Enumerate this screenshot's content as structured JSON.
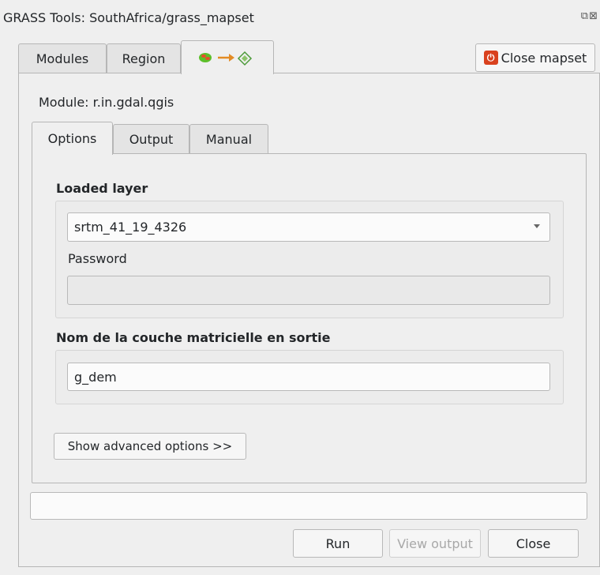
{
  "window": {
    "title": "GRASS Tools: SouthAfrica/grass_mapset"
  },
  "top_tabs": {
    "modules": "Modules",
    "region": "Region"
  },
  "close_mapset": "Close mapset",
  "module": {
    "label": "Module: r.in.gdal.qgis"
  },
  "sub_tabs": {
    "options": "Options",
    "output": "Output",
    "manual": "Manual"
  },
  "loaded_layer": {
    "heading": "Loaded layer",
    "selected": "srtm_41_19_4326",
    "password_label": "Password",
    "password_value": ""
  },
  "output_layer": {
    "heading": "Nom de la couche matricielle en sortie",
    "value": "g_dem"
  },
  "advanced_button": "Show advanced options >>",
  "status_field": "",
  "buttons": {
    "run": "Run",
    "view_output": "View output",
    "close": "Close"
  },
  "colors": {
    "window_bg": "#efefef",
    "close_mapset_icon": "#d9411e",
    "disabled_text": "#a8a8a8"
  }
}
